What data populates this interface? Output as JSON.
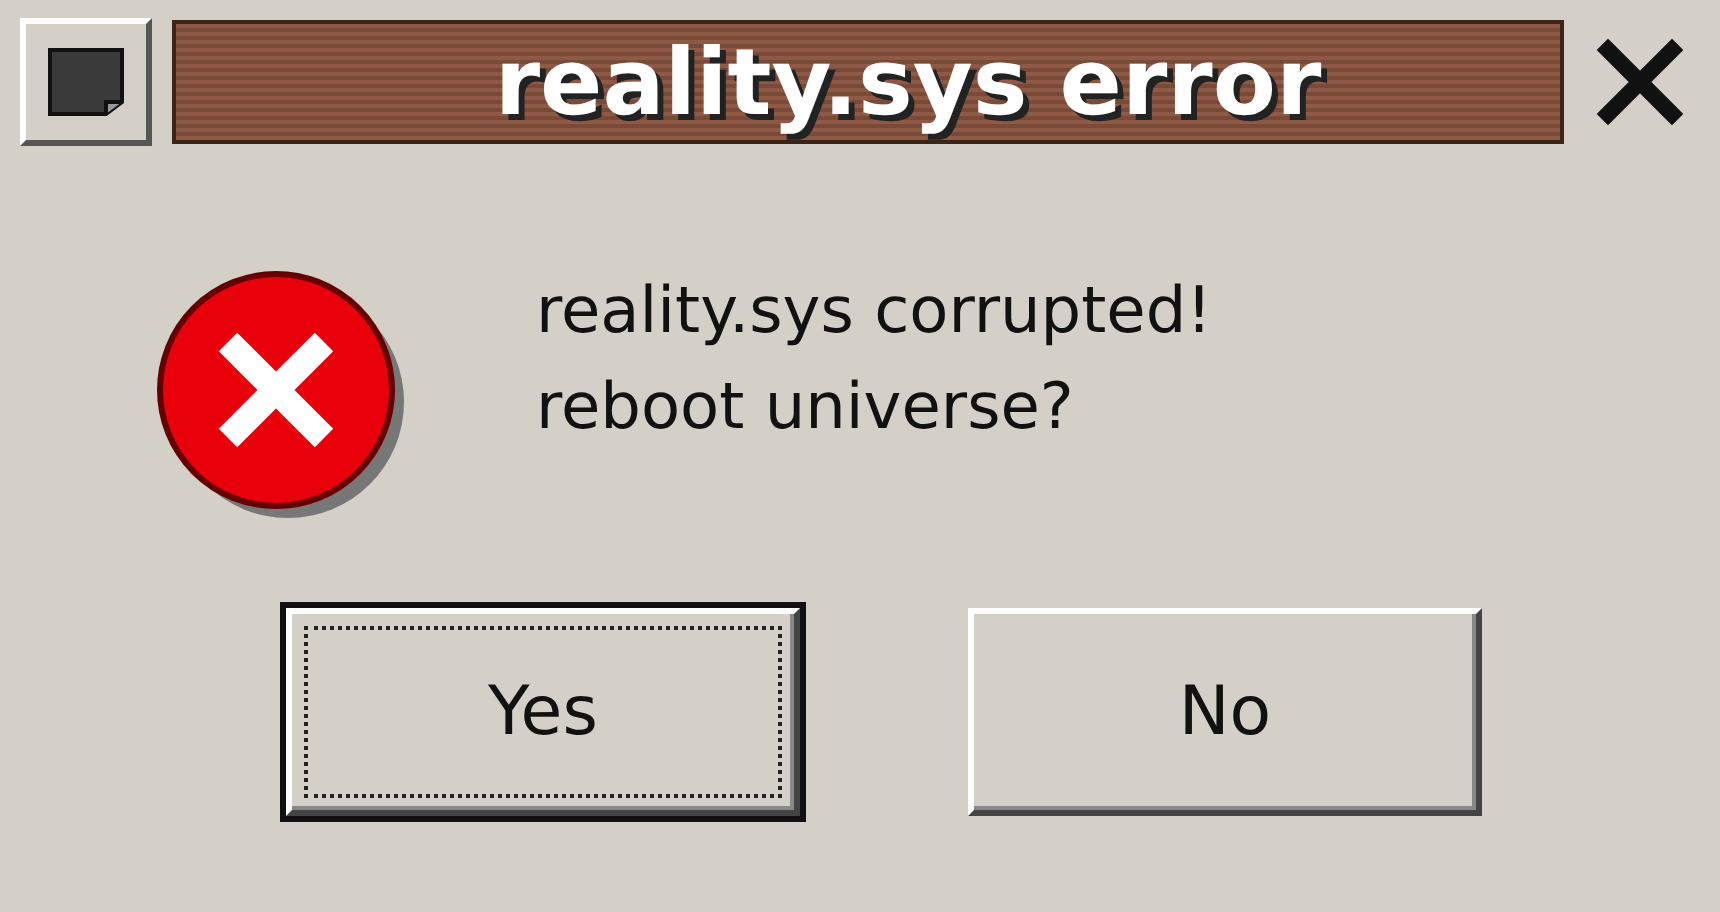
{
  "window": {
    "title": "reality.sys error"
  },
  "message": [
    "reality.sys corrupted!",
    "reboot universe?"
  ],
  "buttons": [
    {
      "label": "Yes",
      "focused": true
    },
    {
      "label": "No",
      "focused": false
    }
  ]
}
